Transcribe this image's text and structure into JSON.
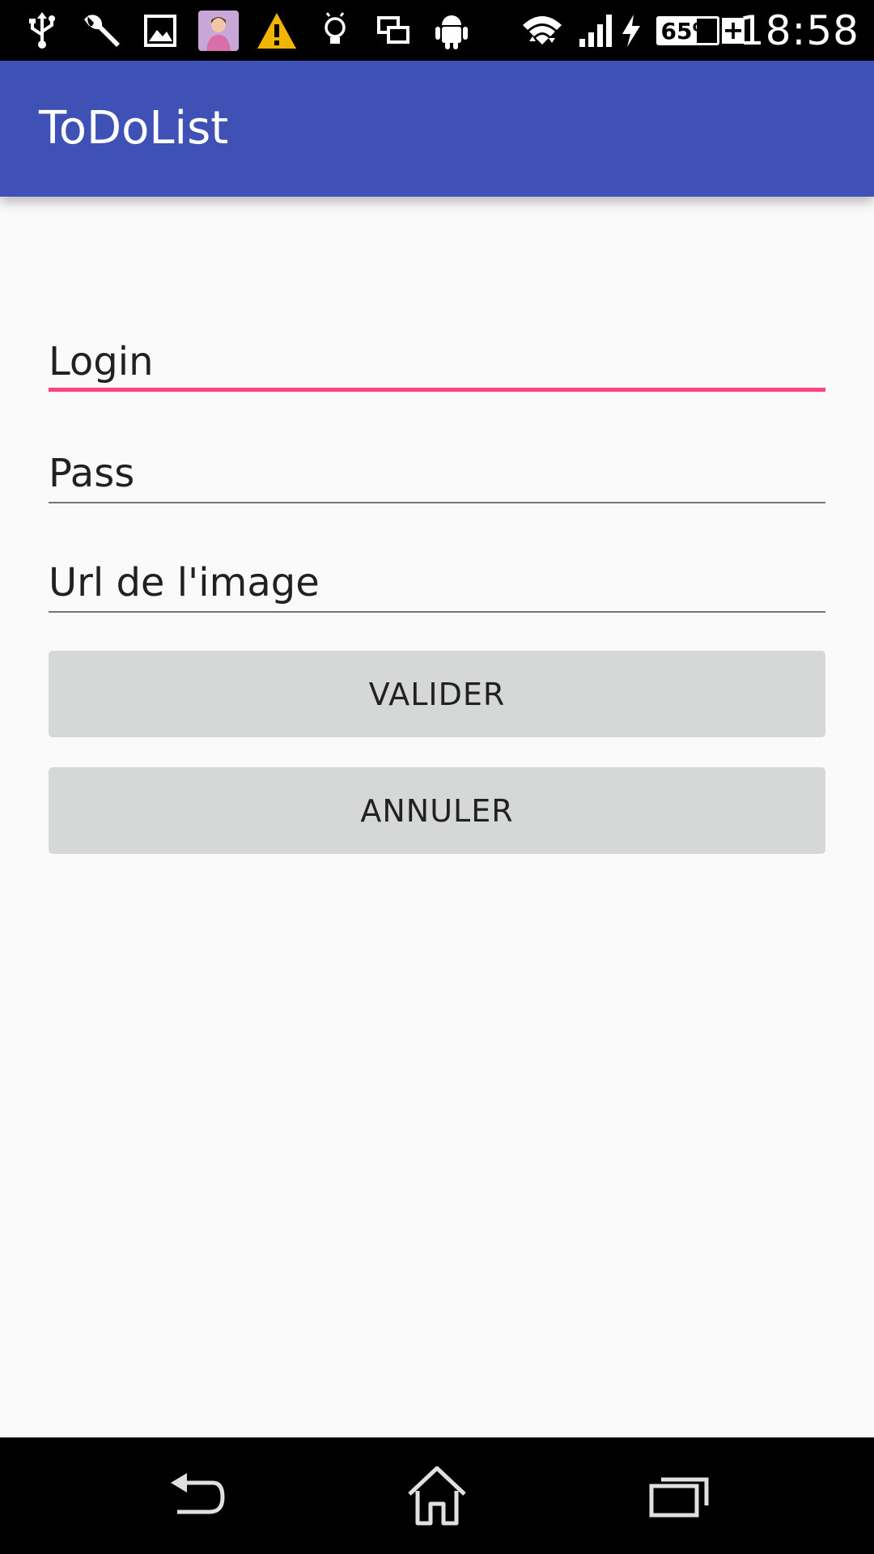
{
  "status_bar": {
    "icons": [
      "usb-icon",
      "wrench-icon",
      "image-icon",
      "avatar-notification-icon",
      "warning-icon",
      "lightbulb-icon",
      "screen-mirror-icon",
      "android-icon",
      "wifi-icon",
      "signal-icon",
      "charging-bolt-icon",
      "battery-icon"
    ],
    "battery_percent": "65%",
    "battery_level": 0.65,
    "time": "18:58"
  },
  "app_bar": {
    "title": "ToDoList",
    "color": "#3f51b5"
  },
  "form": {
    "login_placeholder": "Login",
    "pass_placeholder": "Pass",
    "image_url_placeholder": "Url de l'image",
    "accent_color": "#ff4081",
    "focused_field": "login"
  },
  "buttons": {
    "validate_label": "VALIDER",
    "cancel_label": "ANNULER"
  },
  "nav_bar": {
    "icons": [
      "back-icon",
      "home-icon",
      "recent-apps-icon"
    ]
  }
}
